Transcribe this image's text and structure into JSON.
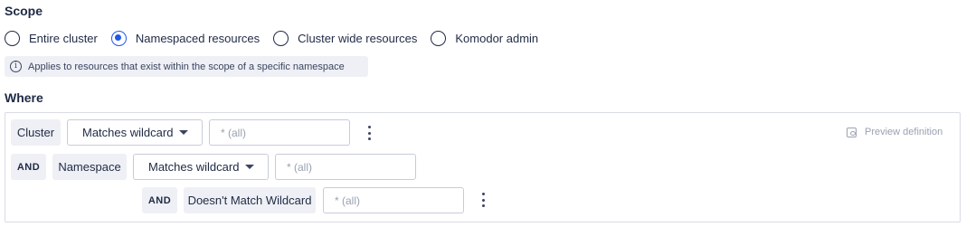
{
  "scope": {
    "title": "Scope",
    "options": [
      {
        "label": "Entire cluster",
        "checked": false
      },
      {
        "label": "Namespaced resources",
        "checked": true
      },
      {
        "label": "Cluster wide resources",
        "checked": false
      },
      {
        "label": "Komodor admin",
        "checked": false
      }
    ],
    "info_text": "Applies to resources that exist within the scope of a specific namespace",
    "info_icon": "info-icon"
  },
  "where": {
    "title": "Where",
    "preview_label": "Preview definition",
    "row1": {
      "field": "Cluster",
      "operator": "Matches wildcard",
      "placeholder": "* (all)"
    },
    "row2": {
      "conjunction": "AND",
      "field": "Namespace",
      "operator": "Matches wildcard",
      "placeholder": "* (all)"
    },
    "row3": {
      "conjunction": "AND",
      "operator": "Doesn't Match Wildcard",
      "placeholder": "* (all)"
    }
  },
  "colors": {
    "accent": "#1f57e8",
    "text": "#1f2a44",
    "chip_bg": "#eef0f5",
    "border": "#c7ccd6"
  }
}
